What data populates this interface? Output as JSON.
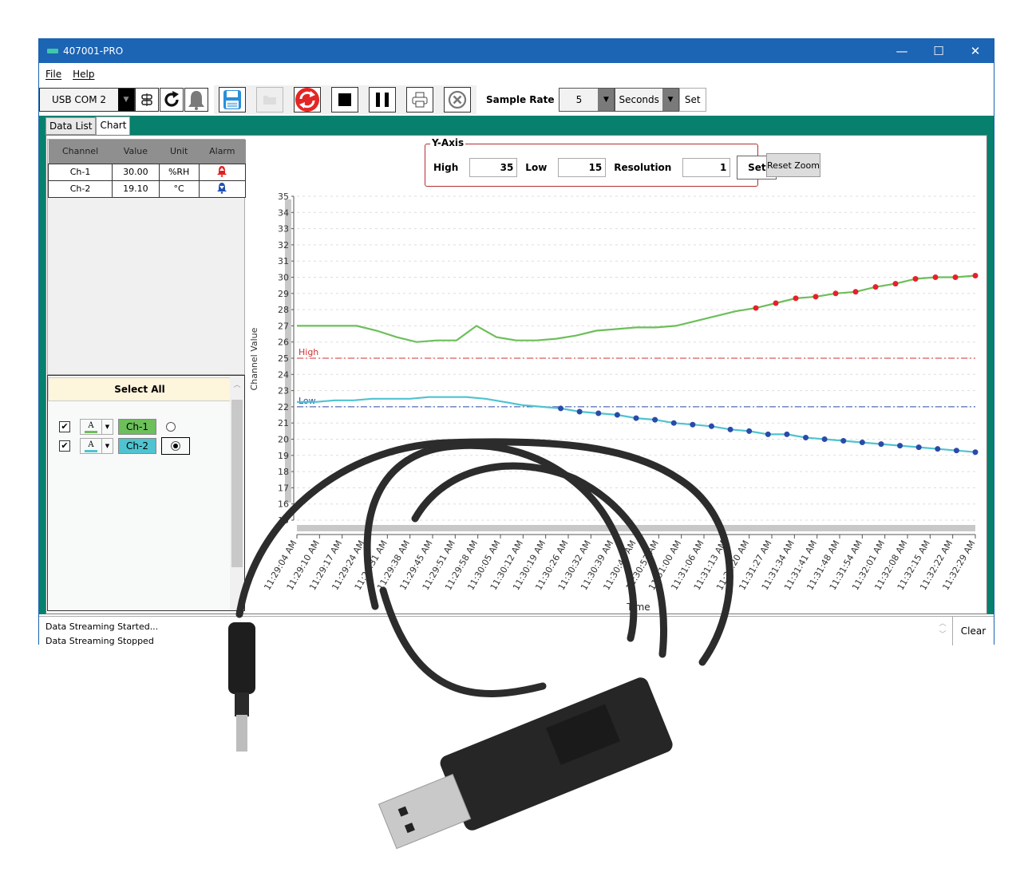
{
  "window": {
    "title": "407001-PRO",
    "minimize": "—",
    "maximize": "☐",
    "close": "✕"
  },
  "menu": [
    {
      "label": "File"
    },
    {
      "label": "Help"
    }
  ],
  "toolbar": {
    "port": "USB COM 2",
    "icons": [
      "disconnect-icon",
      "refresh-icon",
      "alarm-bell-icon",
      "save-icon",
      "open-folder-icon",
      "sync-icon",
      "stop-icon",
      "pause-icon",
      "print-icon",
      "close-circle-icon"
    ],
    "sample_rate_label": "Sample Rate",
    "sample_rate_value": "5",
    "sample_rate_unit": "Seconds",
    "set_label": "Set"
  },
  "tabs": [
    {
      "label": "Data List",
      "active": false
    },
    {
      "label": "Chart",
      "active": true
    }
  ],
  "data_table": {
    "headers": [
      "Channel",
      "Value",
      "Unit",
      "Alarm"
    ],
    "rows": [
      {
        "channel": "Ch-1",
        "value": "30.00",
        "unit": "%RH",
        "alarm": "high-alarm",
        "alarm_color": "#e02020"
      },
      {
        "channel": "Ch-2",
        "value": "19.10",
        "unit": "°C",
        "alarm": "low-alarm",
        "alarm_color": "#2050b0"
      }
    ]
  },
  "channel_select": {
    "select_all": "Select All",
    "channels": [
      {
        "name": "Ch-1",
        "checked": true,
        "color": "#6cbf5a",
        "selected": false
      },
      {
        "name": "Ch-2",
        "checked": true,
        "color": "#4fc3d0",
        "selected": true
      }
    ]
  },
  "y_axis_panel": {
    "legend": "Y-Axis",
    "high_label": "High",
    "high_value": "35",
    "low_label": "Low",
    "low_value": "15",
    "resolution_label": "Resolution",
    "resolution_value": "1",
    "set_label": "Set",
    "reset_zoom": "Reset Zoom"
  },
  "status": {
    "lines": [
      "Data Streaming Started...",
      "Data Streaming Stopped"
    ],
    "clear": "Clear"
  },
  "chart_data": {
    "type": "line",
    "title": "",
    "xlabel": "Time",
    "ylabel": "Channel Value",
    "ylim": [
      15,
      35
    ],
    "yticks": [
      15,
      16,
      17,
      18,
      19,
      20,
      21,
      22,
      23,
      24,
      25,
      26,
      27,
      28,
      29,
      30,
      31,
      32,
      33,
      34,
      35
    ],
    "grid": true,
    "x": [
      "11:29:04 AM",
      "11:29:10 AM",
      "11:29:17 AM",
      "11:29:24 AM",
      "11:29:31 AM",
      "11:29:38 AM",
      "11:29:45 AM",
      "11:29:51 AM",
      "11:29:58 AM",
      "11:30:05 AM",
      "11:30:12 AM",
      "11:30:19 AM",
      "11:30:26 AM",
      "11:30:32 AM",
      "11:30:39 AM",
      "11:30:46 AM",
      "11:30:53 AM",
      "11:31:00 AM",
      "11:31:06 AM",
      "11:31:13 AM",
      "11:31:20 AM",
      "11:31:27 AM",
      "11:31:34 AM",
      "11:31:41 AM",
      "11:31:48 AM",
      "11:31:54 AM",
      "11:32:01 AM",
      "11:32:08 AM",
      "11:32:15 AM",
      "11:32:22 AM",
      "11:32:29 AM"
    ],
    "series": [
      {
        "name": "Ch-1",
        "color": "#6cbf5a",
        "marker_color": "#e8202a",
        "values": [
          27.0,
          27.0,
          27.0,
          27.0,
          26.7,
          26.3,
          26.0,
          26.1,
          26.1,
          27.0,
          26.3,
          26.1,
          26.1,
          26.2,
          26.4,
          26.7,
          26.8,
          26.9,
          26.9,
          27.0,
          27.3,
          27.6,
          27.9,
          28.1,
          28.4,
          28.7,
          28.8,
          29.0,
          29.1,
          29.4,
          29.6,
          29.9,
          30.0,
          30.0,
          30.1
        ]
      },
      {
        "name": "Ch-2",
        "color": "#4fc3d0",
        "marker_color": "#2a4aa8",
        "values": [
          22.3,
          22.3,
          22.4,
          22.4,
          22.5,
          22.5,
          22.5,
          22.6,
          22.6,
          22.6,
          22.5,
          22.3,
          22.1,
          22.0,
          21.9,
          21.7,
          21.6,
          21.5,
          21.3,
          21.2,
          21.0,
          20.9,
          20.8,
          20.6,
          20.5,
          20.3,
          20.3,
          20.1,
          20.0,
          19.9,
          19.8,
          19.7,
          19.6,
          19.5,
          19.4,
          19.3,
          19.2
        ]
      }
    ],
    "alarm_lines": [
      {
        "label": "High",
        "value": 25,
        "color": "#d03030"
      },
      {
        "label": "Low",
        "value": 22,
        "color": "#2a4aa8"
      }
    ],
    "alarm_marker_from_index": {
      "Ch-1": 22,
      "Ch-2": 13
    }
  },
  "product_photo": {
    "description": "USB adapter cable with 3.5mm plug"
  }
}
